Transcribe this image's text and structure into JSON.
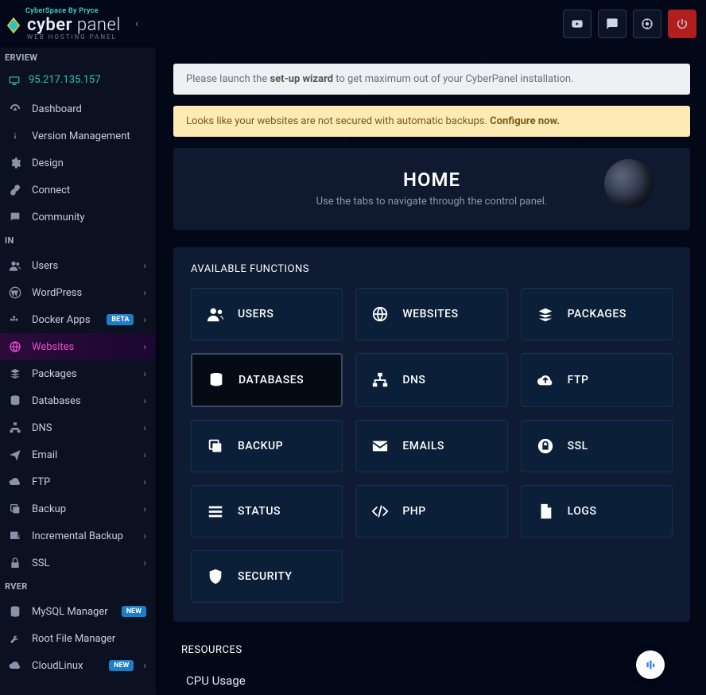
{
  "brand": {
    "tag": "CyberSpace By Pryce",
    "name_a": "cyber",
    "name_b": " panel",
    "sub": "WEB HOSTING PANEL"
  },
  "ip": "95.217.135.157",
  "alert_setup_pre": "Please launch the ",
  "alert_setup_mid": "set-up wizard",
  "alert_setup_post": " to get maximum out of your CyberPanel installation.",
  "alert_backup_pre": "Looks like your websites are not secured with automatic backups. ",
  "alert_backup_link": "Configure now.",
  "home": {
    "title": "HOME",
    "sub": "Use the tabs to navigate through the control panel."
  },
  "panel": {
    "functions_title": "AVAILABLE FUNCTIONS",
    "resources_title": "RESOURCES",
    "cpu": "CPU Usage"
  },
  "sidebar": {
    "overview": "ERVIEW",
    "main": "IN",
    "server": "RVER"
  },
  "nav": {
    "dashboard": "Dashboard",
    "version": "Version Management",
    "design": "Design",
    "connect": "Connect",
    "community": "Community",
    "users": "Users",
    "wordpress": "WordPress",
    "docker": "Docker Apps",
    "websites": "Websites",
    "packages": "Packages",
    "databases": "Databases",
    "dns": "DNS",
    "email": "Email",
    "ftp": "FTP",
    "backup": "Backup",
    "incremental": "Incremental Backup",
    "ssl": "SSL",
    "mysql": "MySQL Manager",
    "rootfile": "Root File Manager",
    "cloudlinux": "CloudLinux"
  },
  "badges": {
    "beta": "BETA",
    "new": "NEW"
  },
  "func": {
    "users": "USERS",
    "websites": "WEBSITES",
    "packages": "PACKAGES",
    "databases": "DATABASES",
    "dns": "DNS",
    "ftp": "FTP",
    "backup": "BACKUP",
    "emails": "EMAILS",
    "ssl": "SSL",
    "status": "STATUS",
    "php": "PHP",
    "logs": "LOGS",
    "security": "SECURITY"
  }
}
